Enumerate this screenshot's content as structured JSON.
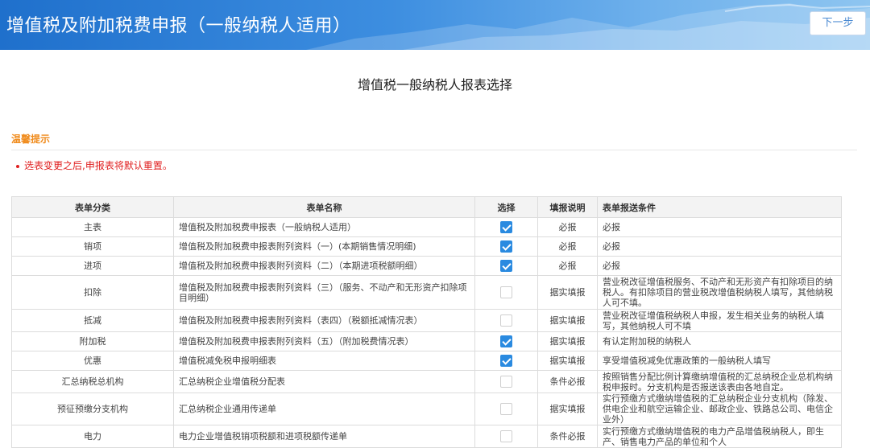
{
  "header": {
    "title": "增值税及附加税费申报（一般纳税人适用）",
    "next_label": "下一步"
  },
  "page_title": "增值税一般纳税人报表选择",
  "tip": {
    "title": "温馨提示",
    "text": "选表变更之后,申报表将默认重置。"
  },
  "table": {
    "headers": [
      "表单分类",
      "表单名称",
      "选择",
      "填报说明",
      "表单报送条件"
    ],
    "rows": [
      {
        "category": "主表",
        "name": "增值税及附加税费申报表（一般纳税人适用）",
        "checked": true,
        "note": "必报",
        "condition": "必报",
        "h": 24
      },
      {
        "category": "销项",
        "name": "增值税及附加税费申报表附列资料（一）(本期销售情况明细)",
        "checked": true,
        "note": "必报",
        "condition": "必报",
        "h": 24
      },
      {
        "category": "进项",
        "name": "增值税及附加税费申报表附列资料（二）（本期进项税额明细）",
        "checked": true,
        "note": "必报",
        "condition": "必报",
        "h": 24
      },
      {
        "category": "扣除",
        "name": "增值税及附加税费申报表附列资料（三）（服务、不动产和无形资产扣除项目明细）",
        "checked": false,
        "note": "据实填报",
        "condition": "营业税改征增值税服务、不动产和无形资产有扣除项目的纳税人。有扣除项目的营业税改增值税纳税人填写，其他纳税人可不填。",
        "h": 42
      },
      {
        "category": "抵减",
        "name": "增值税及附加税费申报表附列资料（表四）（税额抵减情况表）",
        "checked": false,
        "note": "据实填报",
        "condition": "营业税改征增值税纳税人申报，发生相关业务的纳税人填写，其他纳税人可不填",
        "h": 28
      },
      {
        "category": "附加税",
        "name": "增值税及附加税费申报表附列资料（五）（附加税费情况表）",
        "checked": true,
        "note": "据实填报",
        "condition": "有认定附加税的纳税人",
        "h": 24
      },
      {
        "category": "优惠",
        "name": "增值税减免税申报明细表",
        "checked": true,
        "note": "据实填报",
        "condition": "享受增值税减免优惠政策的一般纳税人填写",
        "h": 24
      },
      {
        "category": "汇总纳税总机构",
        "name": "汇总纳税企业增值税分配表",
        "checked": false,
        "note": "条件必报",
        "condition": "按照销售分配比例计算缴纳增值税的汇总纳税企业总机构纳税申报时。分支机构是否报送该表由各地自定。",
        "h": 28
      },
      {
        "category": "预征预缴分支机构",
        "name": "汇总纳税企业通用传递单",
        "checked": false,
        "note": "据实填报",
        "condition": "实行预缴方式缴纳增值税的汇总纳税企业分支机构（除发、供电企业和航空运输企业、邮政企业、铁路总公司、电信企业外）",
        "h": 28
      },
      {
        "category": "电力",
        "name": "电力企业增值税销项税额和进项税额传递单",
        "checked": false,
        "note": "条件必报",
        "condition": "实行预缴方式缴纳增值税的电力产品增值税纳税人，即生产、销售电力产品的单位和个人",
        "h": 28
      }
    ]
  }
}
